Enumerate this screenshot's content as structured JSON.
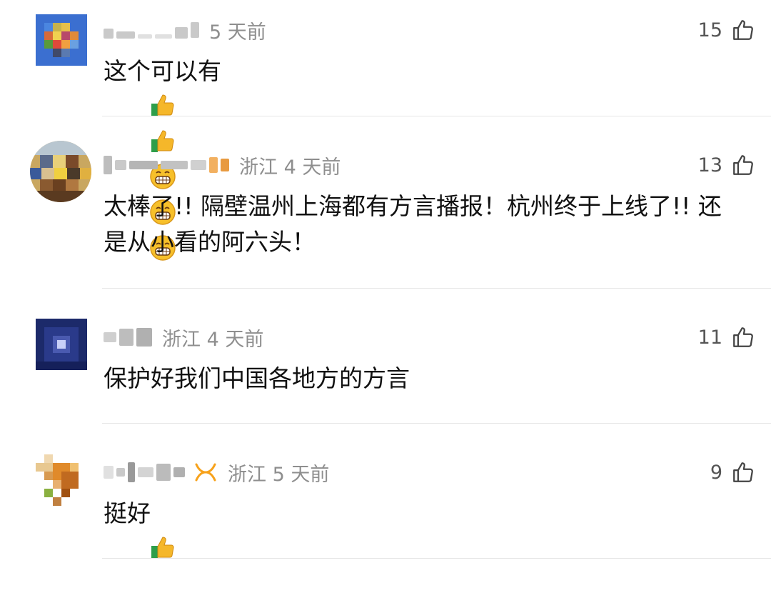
{
  "comments": [
    {
      "meta": "5 天前",
      "likes": "15",
      "text": "这个可以有",
      "emojis": [
        "thumbs-up-icon",
        "thumbs-up-icon",
        "grinning-face-icon",
        "grinning-face-icon",
        "grinning-face-icon"
      ]
    },
    {
      "meta": "浙江 4 天前",
      "likes": "13",
      "text": "太棒了!! 隔壁温州上海都有方言播报！杭州终于上线了!! 还是从小看的阿六头！",
      "emojis": []
    },
    {
      "meta": "浙江 4 天前",
      "likes": "11",
      "text": "保护好我们中国各地方的方言",
      "emojis": []
    },
    {
      "meta": "浙江 5 天前",
      "likes": "9",
      "text": "挺好",
      "emojis": [
        "thumbs-up-icon"
      ]
    }
  ],
  "colors": {
    "meta_gray": "#8e8e8e",
    "divider": "#e6e6e6",
    "badge_orange": "#f7a21b"
  }
}
